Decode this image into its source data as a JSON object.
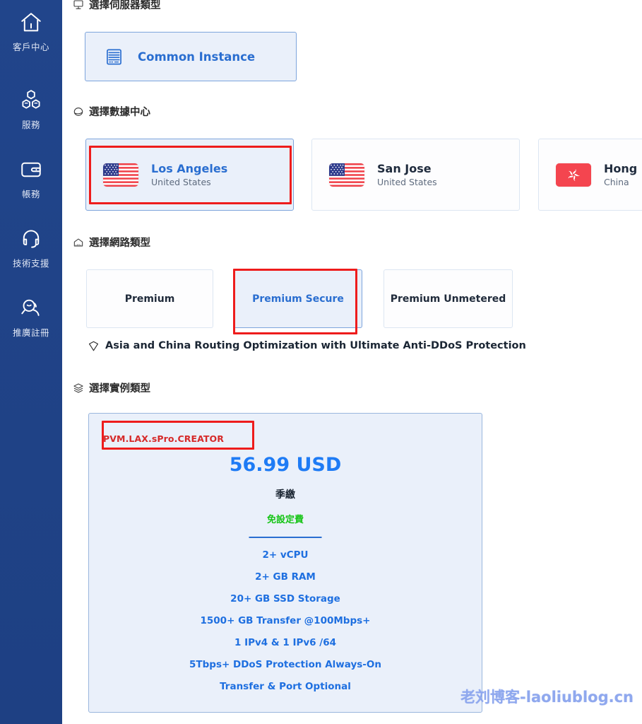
{
  "sidebar": {
    "background_color": "#1f4287",
    "items": [
      {
        "label": "客戶中心",
        "icon": "home-icon"
      },
      {
        "label": "服務",
        "icon": "cubes-icon"
      },
      {
        "label": "帳務",
        "icon": "wallet-icon"
      },
      {
        "label": "技術支援",
        "icon": "headset-icon"
      },
      {
        "label": "推廣註冊",
        "icon": "user-search-icon"
      }
    ]
  },
  "sections": {
    "server_type": {
      "title": "選擇伺服器類型",
      "icon": "server-monitor-icon",
      "options": [
        {
          "label": "Common Instance",
          "icon": "server-rack-icon",
          "selected": true
        }
      ]
    },
    "datacenter": {
      "title": "選擇數據中心",
      "icon": "globe-icon",
      "options": [
        {
          "city": "Los Angeles",
          "country": "United States",
          "flag": "us-flag-icon",
          "selected": true
        },
        {
          "city": "San Jose",
          "country": "United States",
          "flag": "us-flag-icon",
          "selected": false
        },
        {
          "city": "Hong Kong",
          "country": "China",
          "flag": "hk-flag-icon",
          "selected": false
        }
      ]
    },
    "network_type": {
      "title": "選擇網路類型",
      "icon": "network-icon",
      "options": [
        {
          "label": "Premium",
          "selected": false
        },
        {
          "label": "Premium Secure",
          "selected": true
        },
        {
          "label": "Premium Unmetered",
          "selected": false
        }
      ],
      "note": "Asia and China Routing Optimization with Ultimate Anti-DDoS Protection",
      "note_icon": "shield-icon"
    },
    "instance_type": {
      "title": "選擇實例類型",
      "icon": "layers-icon",
      "plan": {
        "name": "PVM.LAX.sPro.CREATOR",
        "price": "56.99 USD",
        "billing_cycle": "季繳",
        "setup_fee": "免設定費",
        "specs": [
          "2+ vCPU",
          "2+ GB RAM",
          "20+ GB SSD Storage",
          "1500+ GB Transfer @100Mbps+",
          "1 IPv4 & 1 IPv6 /64",
          "5Tbps+ DDoS Protection Always-On",
          "Transfer & Port Optional"
        ]
      }
    }
  },
  "annotations": {
    "color": "#ee1c1c",
    "boxes": [
      {
        "target": "datacenter-card-los-angeles"
      },
      {
        "target": "network-card-premium-secure"
      },
      {
        "target": "instance-plan-name"
      }
    ]
  },
  "watermark": {
    "text": "老刘博客-laoliublog.cn",
    "color": "#8fa8ee"
  },
  "colors": {
    "sidebar": "#1f4287",
    "accent_blue": "#2a6ed0",
    "price_blue": "#1e7bf5",
    "setup_green": "#16c416",
    "plan_red": "#d62a2a",
    "selected_card_bg": "#eaf0fa",
    "selected_card_border": "#7da5dc"
  }
}
